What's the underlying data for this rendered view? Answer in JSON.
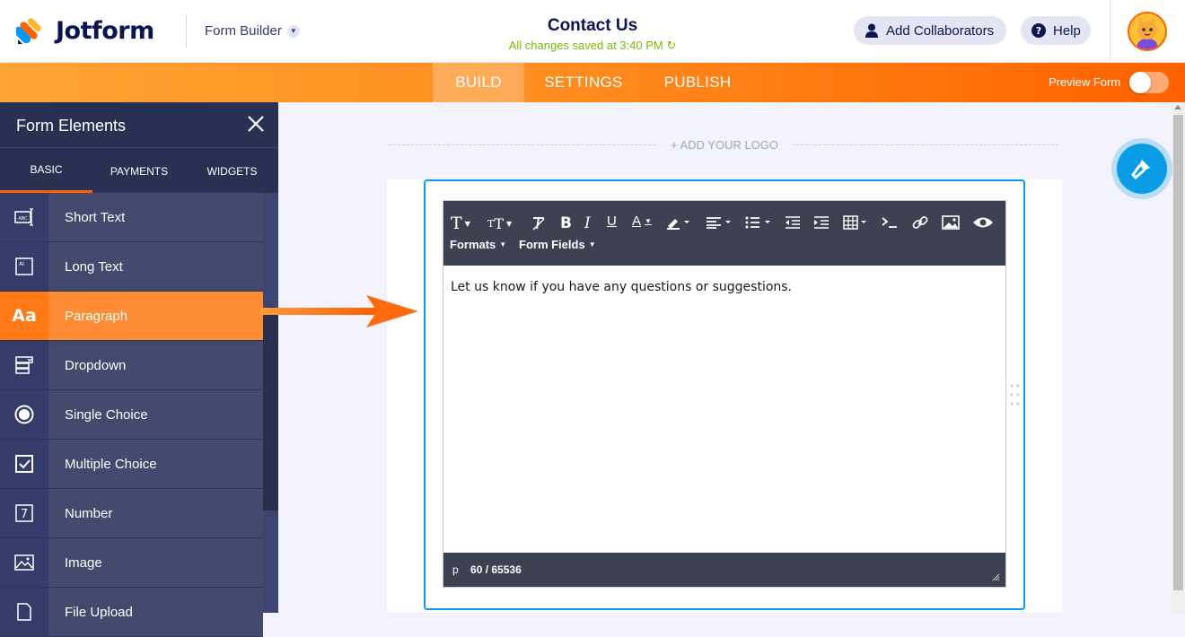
{
  "header": {
    "brand": "Jotform",
    "builder_label": "Form Builder",
    "form_title": "Contact Us",
    "saved_status": "All changes saved at 3:40 PM",
    "collaborators_label": "Add Collaborators",
    "help_label": "Help"
  },
  "nav": {
    "tabs": [
      {
        "label": "BUILD"
      },
      {
        "label": "SETTINGS"
      },
      {
        "label": "PUBLISH"
      }
    ],
    "preview_label": "Preview Form"
  },
  "sidebar": {
    "title": "Form Elements",
    "tabs": [
      {
        "label": "BASIC"
      },
      {
        "label": "PAYMENTS"
      },
      {
        "label": "WIDGETS"
      }
    ],
    "items": [
      {
        "label": "Short Text",
        "icon": "short-text-icon"
      },
      {
        "label": "Long Text",
        "icon": "long-text-icon"
      },
      {
        "label": "Paragraph",
        "icon": "paragraph-icon",
        "active": true
      },
      {
        "label": "Dropdown",
        "icon": "dropdown-icon"
      },
      {
        "label": "Single Choice",
        "icon": "radio-icon"
      },
      {
        "label": "Multiple Choice",
        "icon": "checkbox-icon"
      },
      {
        "label": "Number",
        "icon": "number-icon"
      },
      {
        "label": "Image",
        "icon": "image-icon"
      },
      {
        "label": "File Upload",
        "icon": "upload-icon"
      }
    ]
  },
  "canvas": {
    "add_logo": "+ ADD YOUR LOGO"
  },
  "editor": {
    "formats_label": "Formats",
    "form_fields_label": "Form Fields",
    "content": "Let us know if you have any questions or suggestions.",
    "status_tag": "p",
    "char_count": "60 / 65536"
  },
  "colors": {
    "accent": "#ff6100",
    "navy": "#343c6a",
    "blue": "#0a9ce5",
    "saved_green": "#78bb07"
  }
}
